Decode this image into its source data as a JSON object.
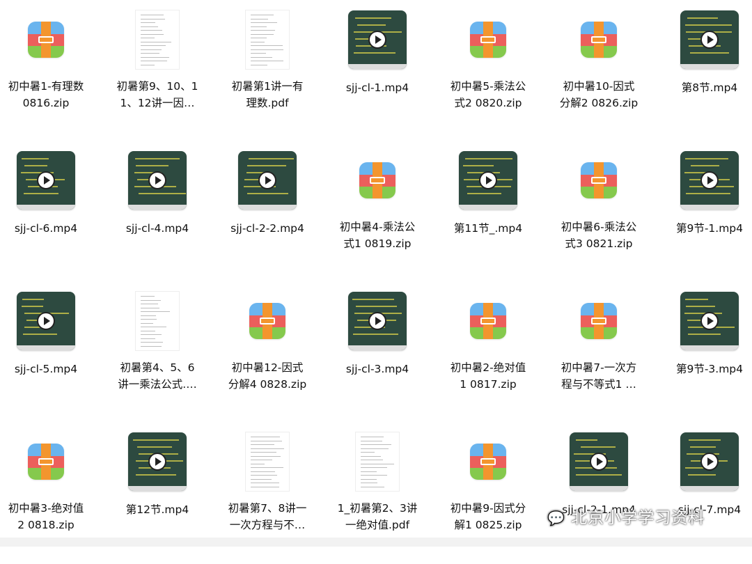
{
  "files": [
    {
      "name": "初中暑1-有理数\n0816.zip",
      "kind": "zip"
    },
    {
      "name": "初暑第9、10、1\n1、12讲一因…",
      "kind": "doc"
    },
    {
      "name": "初暑第1讲一有\n理数.pdf",
      "kind": "doc"
    },
    {
      "name": "sjj-cl-1.mp4",
      "kind": "video"
    },
    {
      "name": "初中暑5-乘法公\n式2 0820.zip",
      "kind": "zip"
    },
    {
      "name": "初中暑10-因式\n分解2 0826.zip",
      "kind": "zip"
    },
    {
      "name": "第8节.mp4",
      "kind": "video"
    },
    {
      "name": "sjj-cl-6.mp4",
      "kind": "video"
    },
    {
      "name": "sjj-cl-4.mp4",
      "kind": "video"
    },
    {
      "name": "sjj-cl-2-2.mp4",
      "kind": "video"
    },
    {
      "name": "初中暑4-乘法公\n式1 0819.zip",
      "kind": "zip"
    },
    {
      "name": "第11节_.mp4",
      "kind": "video"
    },
    {
      "name": "初中暑6-乘法公\n式3 0821.zip",
      "kind": "zip"
    },
    {
      "name": "第9节-1.mp4",
      "kind": "video"
    },
    {
      "name": "sjj-cl-5.mp4",
      "kind": "video"
    },
    {
      "name": "初暑第4、5、6\n讲一乘法公式.…",
      "kind": "doc"
    },
    {
      "name": "初中暑12-因式\n分解4 0828.zip",
      "kind": "zip"
    },
    {
      "name": "sjj-cl-3.mp4",
      "kind": "video"
    },
    {
      "name": "初中暑2-绝对值\n1 0817.zip",
      "kind": "zip"
    },
    {
      "name": "初中暑7-一次方\n程与不等式1 …",
      "kind": "zip"
    },
    {
      "name": "第9节-3.mp4",
      "kind": "video"
    },
    {
      "name": "初中暑3-绝对值\n2 0818.zip",
      "kind": "zip"
    },
    {
      "name": "第12节.mp4",
      "kind": "video"
    },
    {
      "name": "初暑第7、8讲一\n一次方程与不…",
      "kind": "doc"
    },
    {
      "name": "1_初暑第2、3讲\n一绝对值.pdf",
      "kind": "doc"
    },
    {
      "name": "初中暑9-因式分\n解1 0825.zip",
      "kind": "zip"
    },
    {
      "name": "sjj-cl-2-1.mp4",
      "kind": "video"
    },
    {
      "name": "sjj-cl-7.mp4",
      "kind": "video"
    }
  ],
  "watermark": {
    "text": "北京小学学习资料",
    "icon": "wechat-icon"
  }
}
